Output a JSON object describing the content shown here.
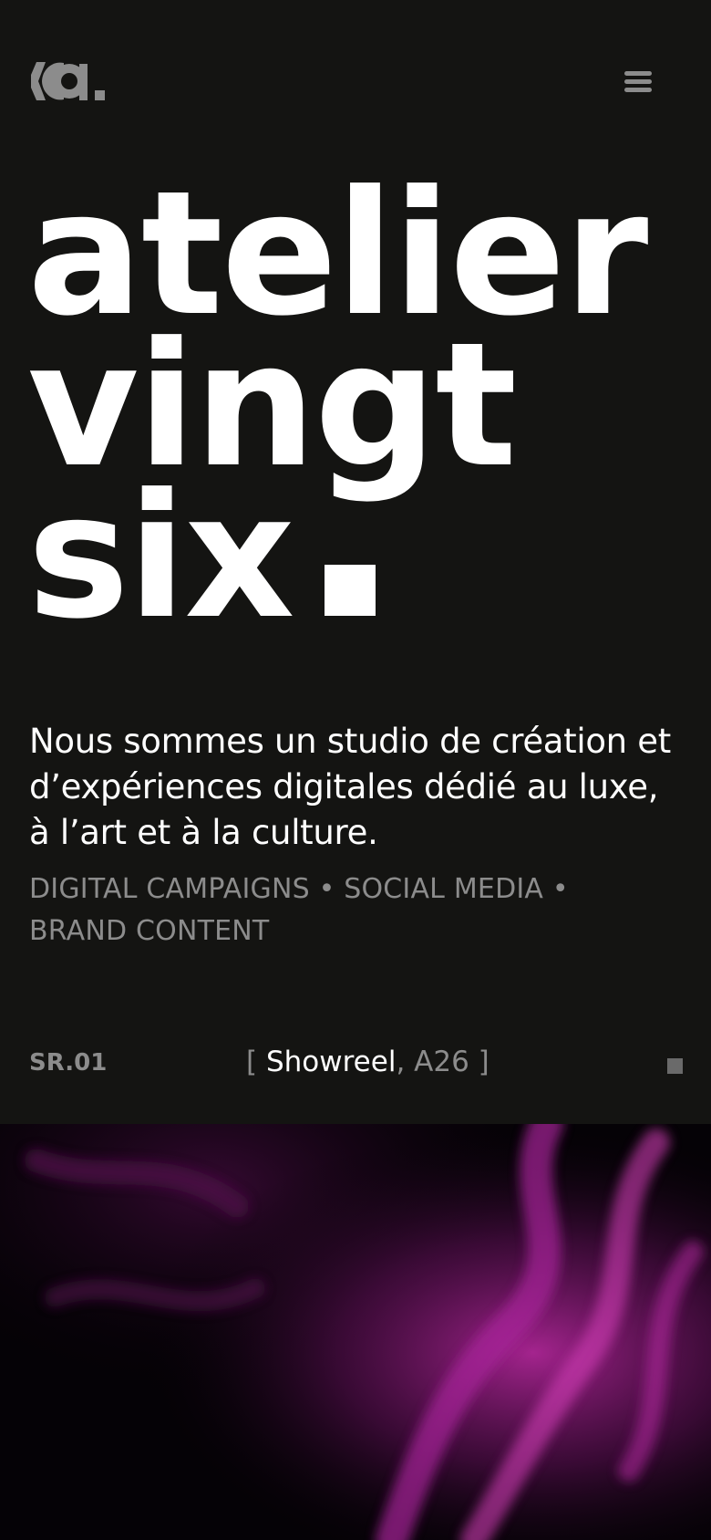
{
  "brand": {
    "logo_text": "ka.",
    "logo_icon": "atelier-vingt-six-logo"
  },
  "header": {
    "menu_icon": "hamburger-menu-icon"
  },
  "hero": {
    "title_lines": [
      "atelier",
      "vingt",
      "six"
    ],
    "intro": "Nous sommes un studio de création et d’expériences digitales dédié au luxe, à l’art et à la culture.",
    "services_line1": "DIGITAL CAMPAIGNS • SOCIAL MEDIA •",
    "services_line2": "BRAND CONTENT"
  },
  "showreel": {
    "code": "SR.01",
    "bracket_open": "[",
    "title": "Showreel",
    "separator": ",",
    "year": "A26",
    "bracket_close": "]",
    "stop_icon": "stop-icon"
  },
  "colors": {
    "background": "#141412",
    "text": "#ffffff",
    "muted": "#8c8c8c",
    "smoke": "#a0208c"
  }
}
